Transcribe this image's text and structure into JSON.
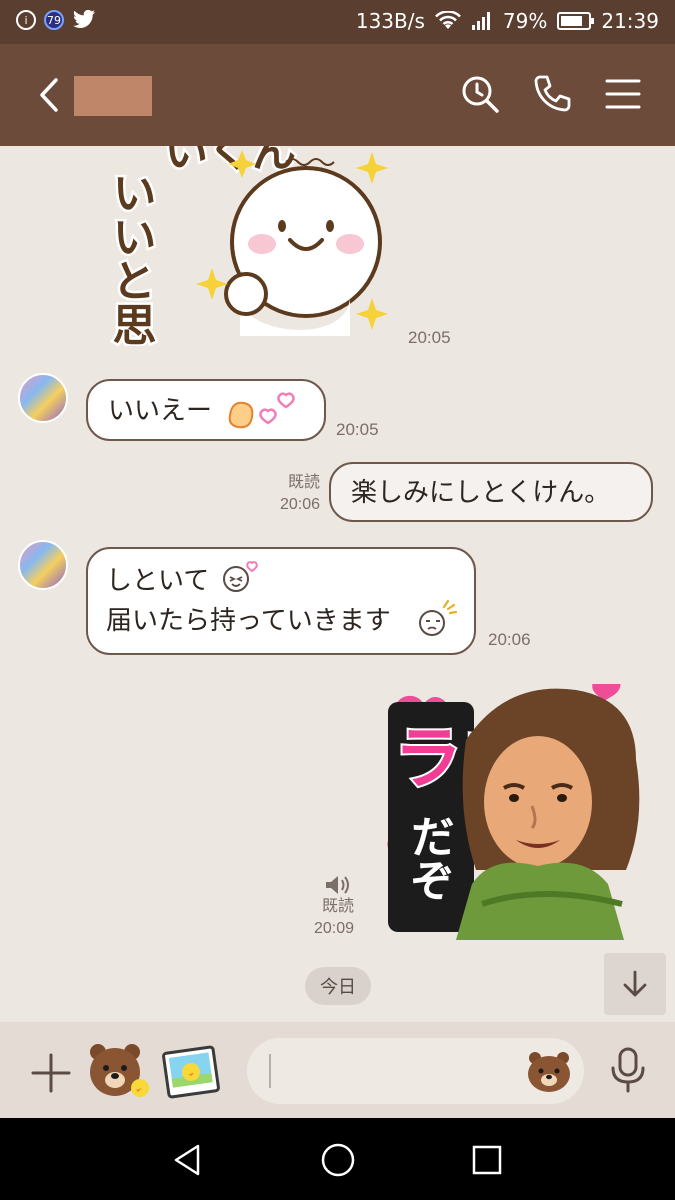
{
  "status_bar": {
    "badge_count": "79",
    "net_speed": "133B/s",
    "battery": "79%",
    "battery_level": 0.79,
    "clock": "21:39"
  },
  "header": {
    "title": ""
  },
  "messages": {
    "sticker1_time": "20:05",
    "sticker1_text": [
      "いくん",
      "いいと思う"
    ],
    "msg1": {
      "text": "いいえー",
      "time": "20:05"
    },
    "msg2": {
      "read": "既読",
      "time": "20:06",
      "text": "楽しみにしとくけん。"
    },
    "msg3": {
      "line1": "しといて",
      "line2": "届いたら持っていきます",
      "time": "20:06"
    },
    "sticker2": {
      "read": "既読",
      "time": "20:09",
      "text1": "ラブ",
      "text2": "だぞ"
    }
  },
  "date_badge": "今日",
  "input": {
    "placeholder": ""
  },
  "colors": {
    "status_bar": "#5a3e30",
    "header": "#6d4b3a",
    "chat_bg": "#ede7e2",
    "bubble_border": "#6e584c",
    "input_bar": "#e4dbd4"
  },
  "icons": {
    "back": "chevron-left-icon",
    "search": "search-icon",
    "call": "phone-icon",
    "menu": "menu-icon",
    "plus": "plus-icon",
    "sticker": "brown-bear-sticker-icon",
    "photo": "photo-icon",
    "emoji": "bear-face-icon",
    "mic": "microphone-icon",
    "scroll_down": "arrow-down-icon",
    "sound": "speaker-icon"
  }
}
